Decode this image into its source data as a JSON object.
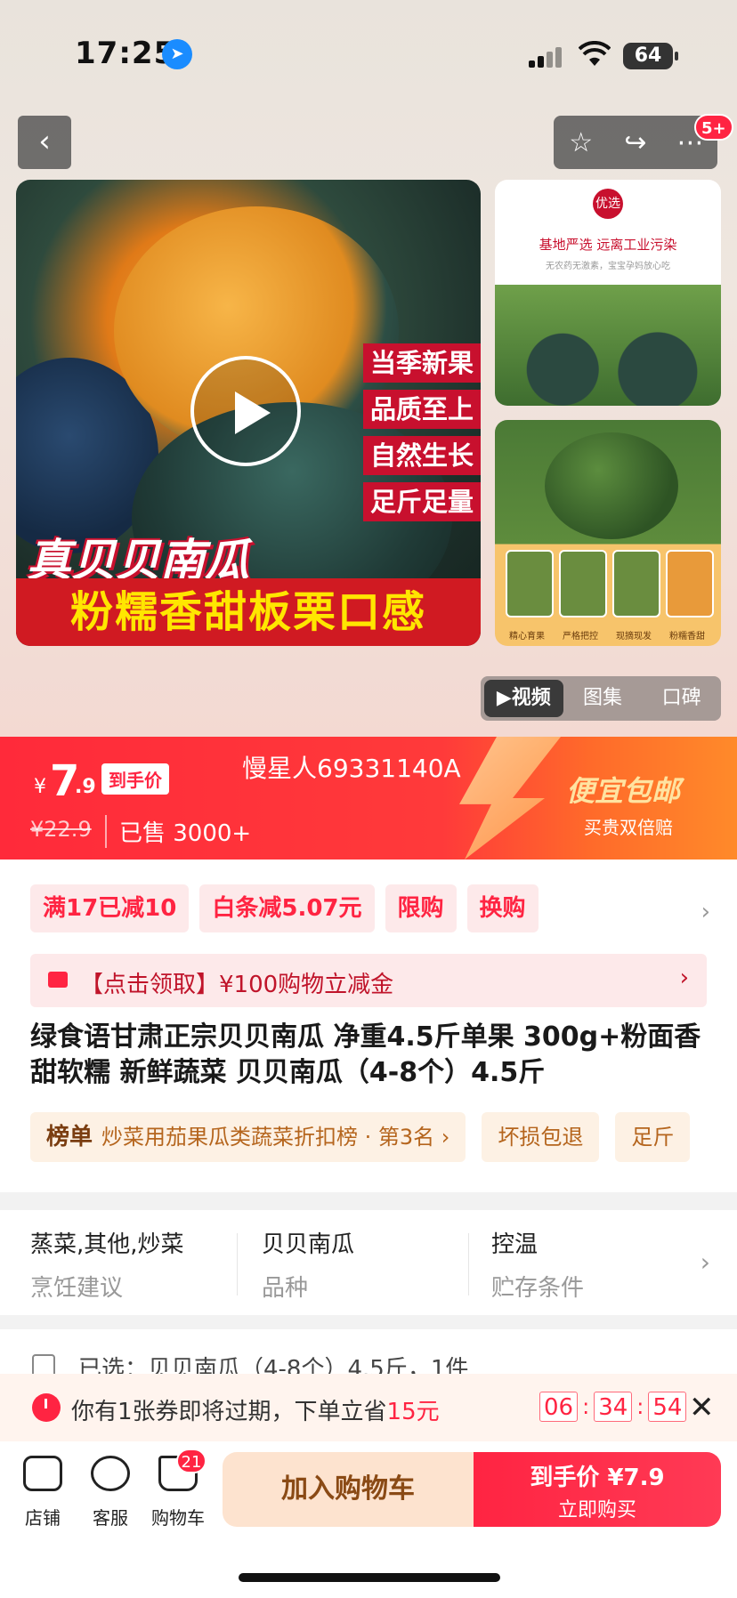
{
  "status_bar": {
    "time": "17:25",
    "battery": "64"
  },
  "header": {
    "back": "‹",
    "badge": "5+"
  },
  "hero": {
    "tags": [
      "当季新果",
      "品质至上",
      "自然生长",
      "足斤足量"
    ],
    "title_line1": "真贝贝南瓜",
    "title_line2": "粉糯香甜板栗口感",
    "thumb1_seal": "优选",
    "thumb1_line1": "基地严选 远离工业污染",
    "thumb1_line2": "无农药无激素，宝宝孕妈放心吃",
    "thumb2_captions": [
      "精心育果",
      "严格把控",
      "现摘现发",
      "粉糯香甜"
    ],
    "media_tabs": [
      "▶视频",
      "图集",
      "口碑"
    ]
  },
  "price": {
    "currency": "¥",
    "integer": "7",
    "decimal": ".9",
    "arrival_label": "到手价",
    "original": "¥22.9",
    "sold": "已售 3000+",
    "watermark": "慢星人69331140A",
    "promo_title": "便宜包邮",
    "promo_sub": "买贵双倍赔"
  },
  "promos": [
    "满17已减10",
    "白条减5.07元",
    "限购",
    "换购"
  ],
  "coupon": {
    "text": "【点击领取】¥100购物立减金"
  },
  "product": {
    "title": "绿食语甘肃正宗贝贝南瓜 净重4.5斤单果 300g+粉面香甜软糯 新鲜蔬菜 贝贝南瓜（4-8个）4.5斤"
  },
  "rank_row": {
    "rank_label": "榜单",
    "rank_text": "炒菜用茄果瓜类蔬菜折扣榜 · 第3名 ›",
    "tag2": "坏损包退",
    "tag3": "足斤"
  },
  "attributes": [
    {
      "value": "蒸菜,其他,炒菜",
      "key": "烹饪建议"
    },
    {
      "value": "贝贝南瓜",
      "key": "品种"
    },
    {
      "value": "控温",
      "key": "贮存条件"
    }
  ],
  "selected": {
    "text": "已选：贝贝南瓜（4-8个）4.5斤，1件"
  },
  "expiry": {
    "text_pre": "你有1张券即将过期，下单立省",
    "text_amount": "15元",
    "hh": "06",
    "mm": "34",
    "ss": "54"
  },
  "bottom_nav": {
    "store": "店铺",
    "service": "客服",
    "cart": "购物车",
    "cart_count": "21",
    "add_cart": "加入购物车",
    "buy_line1": "到手价 ¥7.9",
    "buy_line2": "立即购买"
  }
}
